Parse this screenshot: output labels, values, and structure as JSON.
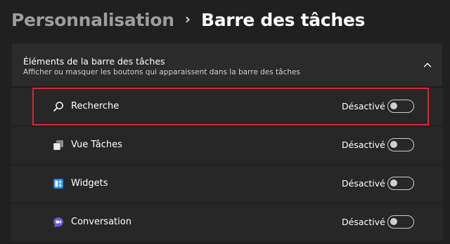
{
  "breadcrumb": {
    "parent": "Personnalisation",
    "separator": "›",
    "current": "Barre des tâches"
  },
  "group": {
    "title": "Éléments de la barre des tâches",
    "subtitle": "Afficher ou masquer les boutons qui apparaissent dans la barre des tâches",
    "collapse_icon": "chevron-up-icon"
  },
  "items": [
    {
      "label": "Recherche",
      "icon": "search-icon",
      "state": "Désactivé",
      "on": false,
      "highlighted": true
    },
    {
      "label": "Vue Tâches",
      "icon": "task-view-icon",
      "state": "Désactivé",
      "on": false
    },
    {
      "label": "Widgets",
      "icon": "widgets-icon",
      "state": "Désactivé",
      "on": false
    },
    {
      "label": "Conversation",
      "icon": "chat-icon",
      "state": "Désactivé",
      "on": false
    }
  ],
  "colors": {
    "background": "#202020",
    "row": "#272727",
    "highlight": "#d42a2e",
    "widgets_accent": "#2d8ad9",
    "chat_accent": "#6b5bd9"
  }
}
